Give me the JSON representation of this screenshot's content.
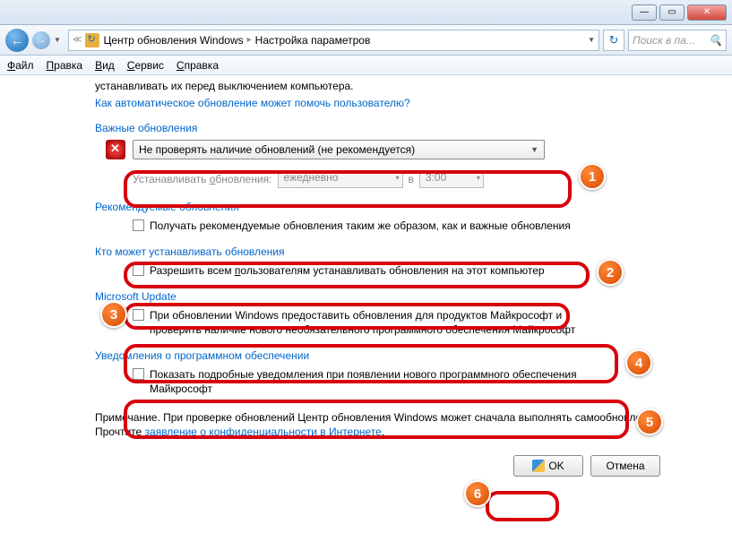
{
  "breadcrumb": {
    "seg1": "Центр обновления Windows",
    "seg2": "Настройка параметров"
  },
  "search": {
    "placeholder": "Поиск в па..."
  },
  "menu": {
    "file": "Файл",
    "edit": "Правка",
    "view": "Вид",
    "tools": "Сервис",
    "help": "Справка"
  },
  "intro": {
    "line1": "устанавливать их перед выключением компьютера.",
    "link": "Как автоматическое обновление может помочь пользователю?"
  },
  "sections": {
    "important": "Важные обновления",
    "recommended": "Рекомендуемые обновления",
    "who": "Кто может устанавливать обновления",
    "msupdate": "Microsoft Update",
    "notify": "Уведомления о программном обеспечении"
  },
  "dropdown": {
    "value": "Не проверять наличие обновлений (не рекомендуется)"
  },
  "schedule": {
    "label": "Устанавливать обновления:",
    "freq": "ежедневно",
    "at": "в",
    "time": "3:00"
  },
  "chk": {
    "recommended": "Получать рекомендуемые обновления таким же образом, как и важные обновления",
    "allow_users": "Разрешить всем пользователям устанавливать обновления на этот компьютер",
    "msupdate": "При обновлении Windows предоставить обновления для продуктов Майкрософт и проверить наличие нового необязательного программного обеспечения Майкрософт",
    "notify": "Показать подробные уведомления при появлении нового программного обеспечения Майкрософт"
  },
  "note": {
    "pre": "Примечание. При проверке обновлений Центр обновления Windows может сначала выполнять самообновление. Прочтите ",
    "link": "заявление о конфиденциальности в Интернете",
    "post": "."
  },
  "buttons": {
    "ok": "OK",
    "cancel": "Отмена"
  },
  "badges": {
    "b1": "1",
    "b2": "2",
    "b3": "3",
    "b4": "4",
    "b5": "5",
    "b6": "6"
  },
  "under_chars": {
    "file_u": "Ф",
    "file_r": "айл",
    "edit_u": "П",
    "edit_r": "равка",
    "view_u": "В",
    "view_r": "ид",
    "tools_u": "С",
    "tools_r": "ервис",
    "help_u": "С",
    "help_r": "правка",
    "sched_u": "о",
    "sched_pre": "Устанавливать ",
    "sched_post": "бновления:",
    "users_u": "п",
    "users_pre": "Разрешить всем ",
    "users_post": "ользователям устанавливать обновления на этот компьютер"
  }
}
